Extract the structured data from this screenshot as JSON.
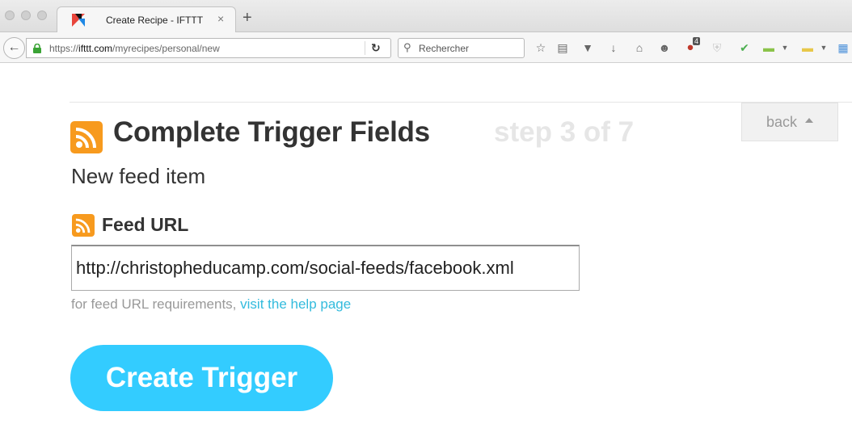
{
  "browser": {
    "tab_title": "Create Recipe - IFTTT",
    "tab_close": "×",
    "new_tab": "+",
    "url_host_prefix": "https://",
    "url_host": "ifttt.com",
    "url_path": "/myrecipes/personal/new",
    "search_placeholder": "Rechercher",
    "ublock_badge": "4",
    "icons": [
      "back-arrow-icon",
      "lock-icon",
      "reload-icon",
      "search-icon",
      "bookmark-star-icon",
      "reading-list-icon",
      "pocket-icon",
      "download-icon",
      "home-icon",
      "smiley-icon",
      "ublock-icon",
      "shield-icon",
      "checkmark-icon",
      "green-folder-icon",
      "yellow-folder-icon"
    ]
  },
  "page": {
    "title": "Complete Trigger Fields",
    "step": "step 3 of 7",
    "back_label": "back",
    "subtitle": "New feed item",
    "field_label": "Feed URL",
    "field_value": "http://christopheducamp.com/social-feeds/facebook.xml",
    "help_text": "for feed URL requirements,",
    "help_link": "visit the help page",
    "create_button": "Create Trigger"
  },
  "colors": {
    "rss_orange": "#f79a1e",
    "button_blue": "#33ccff",
    "link_blue": "#33bbdd",
    "step_grey": "#e6e6e6"
  }
}
